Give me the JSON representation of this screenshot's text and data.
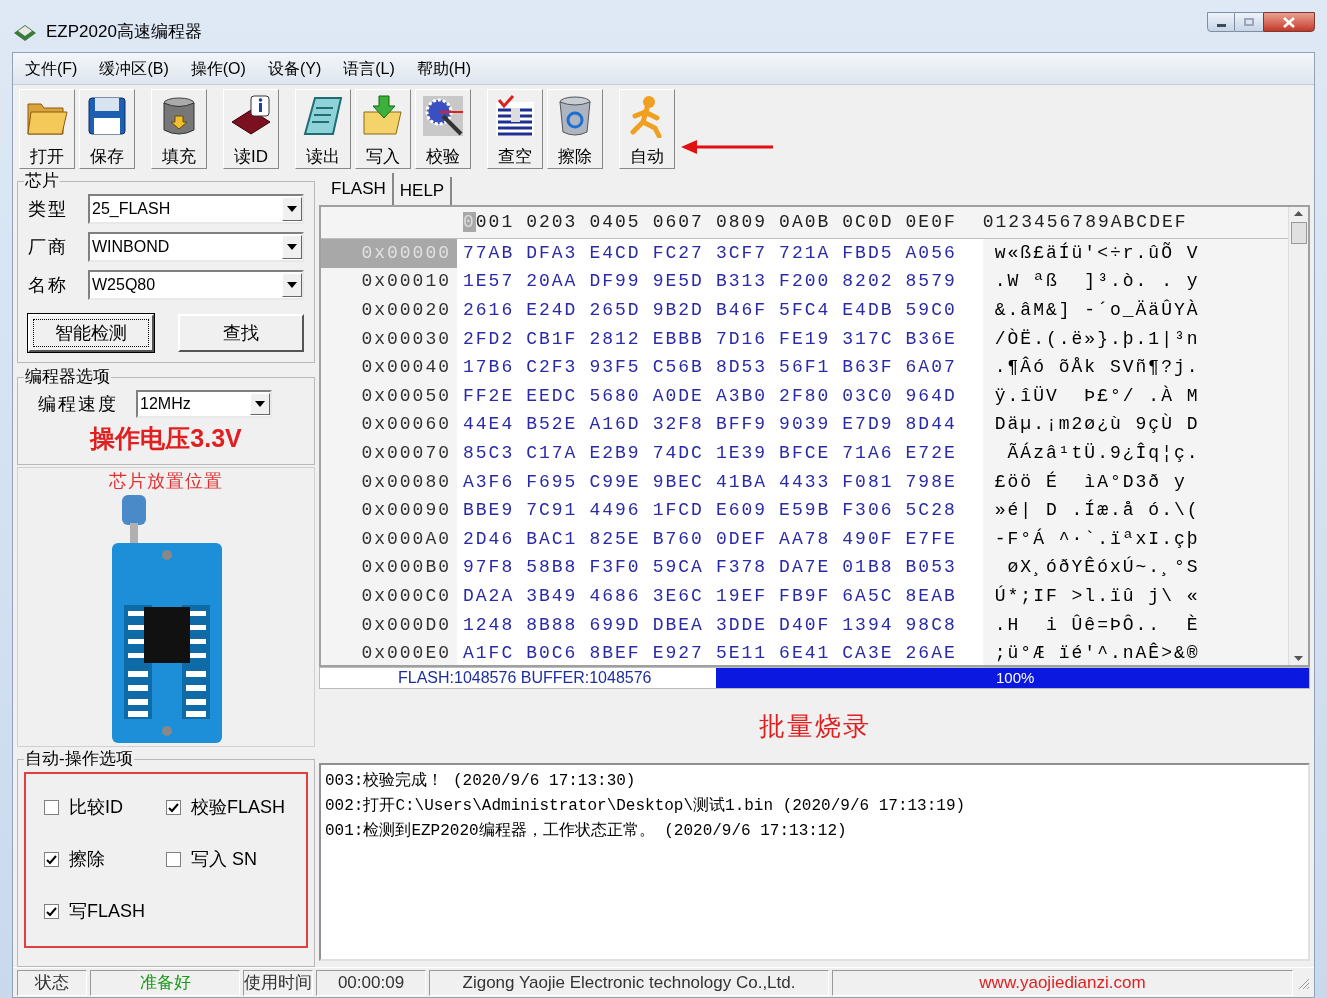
{
  "window": {
    "title": "EZP2020高速编程器"
  },
  "menu": [
    "文件(F)",
    "缓冲区(B)",
    "操作(O)",
    "设备(Y)",
    "语言(L)",
    "帮助(H)"
  ],
  "toolbar": [
    "打开",
    "保存",
    "填充",
    "读ID",
    "读出",
    "写入",
    "校验",
    "查空",
    "擦除",
    "自动"
  ],
  "chip": {
    "title": "芯片",
    "fields": [
      {
        "label": "类型",
        "value": "25_FLASH"
      },
      {
        "label": "厂商",
        "value": "WINBOND"
      },
      {
        "label": "名称",
        "value": "W25Q80"
      }
    ],
    "buttons": [
      {
        "label": "智能检测",
        "focused": true
      },
      {
        "label": "查找",
        "focused": false
      }
    ]
  },
  "programmer_options": {
    "title": "编程器选项",
    "speed_label": "编程速度",
    "speed": "12MHz",
    "voltage": "操作电压3.3V"
  },
  "socket_caption": "芯片放置位置",
  "auto_options": {
    "title": "自动-操作选项",
    "checkboxes": [
      {
        "label": "比较ID",
        "checked": false
      },
      {
        "label": "校验FLASH",
        "checked": true
      },
      {
        "label": "擦除",
        "checked": true
      },
      {
        "label": "写入 SN",
        "checked": false
      },
      {
        "label": "写FLASH",
        "checked": true
      }
    ]
  },
  "tabs": [
    {
      "label": "FLASH",
      "selected": true
    },
    {
      "label": "HELP",
      "selected": false
    }
  ],
  "hex": {
    "columns": [
      {
        "label": "0001",
        "cursor": true
      },
      {
        "label": "0203",
        "cursor": false
      },
      {
        "label": "0405",
        "cursor": false
      },
      {
        "label": "0607",
        "cursor": false
      },
      {
        "label": "0809",
        "cursor": false
      },
      {
        "label": "0A0B",
        "cursor": false
      },
      {
        "label": "0C0D",
        "cursor": false
      },
      {
        "label": "0E0F",
        "cursor": false
      }
    ],
    "ascii_header": "0123456789ABCDEF",
    "rows": [
      {
        "address": "0x00000",
        "selected": true,
        "words": [
          "77AB",
          "DFA3",
          "E4CD",
          "FC27",
          "3CF7",
          "721A",
          "FBD5",
          "A056"
        ],
        "ascii": "w«ß£äÍü'<÷r.ûÕ V"
      },
      {
        "address": "0x00010",
        "selected": false,
        "words": [
          "1E57",
          "20AA",
          "DF99",
          "9E5D",
          "B313",
          "F200",
          "8202",
          "8579"
        ],
        "ascii": ".W ªß  ]³.ò. . y"
      },
      {
        "address": "0x00020",
        "selected": false,
        "words": [
          "2616",
          "E24D",
          "265D",
          "9B2D",
          "B46F",
          "5FC4",
          "E4DB",
          "59C0"
        ],
        "ascii": "&.âM&] -´o_ÄäÛYÀ"
      },
      {
        "address": "0x00030",
        "selected": false,
        "words": [
          "2FD2",
          "CB1F",
          "2812",
          "EBBB",
          "7D16",
          "FE19",
          "317C",
          "B36E"
        ],
        "ascii": "/ÒË.(.ë»}.þ.1|³n"
      },
      {
        "address": "0x00040",
        "selected": false,
        "words": [
          "17B6",
          "C2F3",
          "93F5",
          "C56B",
          "8D53",
          "56F1",
          "B63F",
          "6A07"
        ],
        "ascii": ".¶Âó õÅk SVñ¶?j."
      },
      {
        "address": "0x00050",
        "selected": false,
        "words": [
          "FF2E",
          "EEDC",
          "5680",
          "A0DE",
          "A3B0",
          "2F80",
          "03C0",
          "964D"
        ],
        "ascii": "ÿ.îÜV  Þ£°/ .À M"
      },
      {
        "address": "0x00060",
        "selected": false,
        "words": [
          "44E4",
          "B52E",
          "A16D",
          "32F8",
          "BFF9",
          "9039",
          "E7D9",
          "8D44"
        ],
        "ascii": "Däµ.¡m2ø¿ù 9çÙ D"
      },
      {
        "address": "0x00070",
        "selected": false,
        "words": [
          "85C3",
          "C17A",
          "E2B9",
          "74DC",
          "1E39",
          "BFCE",
          "71A6",
          "E72E"
        ],
        "ascii": " ÃÁzâ¹tÜ.9¿Îq¦ç."
      },
      {
        "address": "0x00080",
        "selected": false,
        "words": [
          "A3F6",
          "F695",
          "C99E",
          "9BEC",
          "41BA",
          "4433",
          "F081",
          "798E"
        ],
        "ascii": "£öö É  ìA°D3ð y"
      },
      {
        "address": "0x00090",
        "selected": false,
        "words": [
          "BBE9",
          "7C91",
          "4496",
          "1FCD",
          "E609",
          "E59B",
          "F306",
          "5C28"
        ],
        "ascii": "»é| D .Íæ.å ó.\\("
      },
      {
        "address": "0x000A0",
        "selected": false,
        "words": [
          "2D46",
          "BAC1",
          "825E",
          "B760",
          "0DEF",
          "AA78",
          "490F",
          "E7FE"
        ],
        "ascii": "-F°Á ^·`.ïªxI.çþ"
      },
      {
        "address": "0x000B0",
        "selected": false,
        "words": [
          "97F8",
          "58B8",
          "F3F0",
          "59CA",
          "F378",
          "DA7E",
          "01B8",
          "B053"
        ],
        "ascii": " øX¸óðYÊóxÚ~.¸°S"
      },
      {
        "address": "0x000C0",
        "selected": false,
        "words": [
          "DA2A",
          "3B49",
          "4686",
          "3E6C",
          "19EF",
          "FB9F",
          "6A5C",
          "8EAB"
        ],
        "ascii": "Ú*;IF >l.ïû j\\ «"
      },
      {
        "address": "0x000D0",
        "selected": false,
        "words": [
          "1248",
          "8B88",
          "699D",
          "DBEA",
          "3DDE",
          "D40F",
          "1394",
          "98C8"
        ],
        "ascii": ".H  i Ûê=ÞÔ..  È"
      },
      {
        "address": "0x000E0",
        "selected": false,
        "words": [
          "A1FC",
          "B0C6",
          "8BEF",
          "E927",
          "5E11",
          "6E41",
          "CA3E",
          "26AE"
        ],
        "ascii": ";ü°Æ ïé'^.nAÊ>&®"
      }
    ]
  },
  "buffer_info": "FLASH:1048576 BUFFER:1048576",
  "progress": {
    "level": 1,
    "label": "100%"
  },
  "mode_label": "批量烧录",
  "log": [
    "003:校验完成！ (2020/9/6 17:13:30)",
    "002:打开C:\\Users\\Administrator\\Desktop\\测试1.bin (2020/9/6 17:13:19)",
    "001:检测到EZP2020编程器，工作状态正常。 (2020/9/6 17:13:12)"
  ],
  "status_bar": [
    {
      "kind": "label",
      "text": "状态"
    },
    {
      "kind": "status",
      "text": "准备好"
    },
    {
      "kind": "label",
      "text": "使用时间"
    },
    {
      "kind": "value",
      "text": "00:00:09"
    },
    {
      "kind": "company",
      "text": "Zigong Yaojie Electronic technology Co.,Ltd."
    },
    {
      "kind": "link",
      "text": "www.yaojiedianzi.com"
    }
  ]
}
